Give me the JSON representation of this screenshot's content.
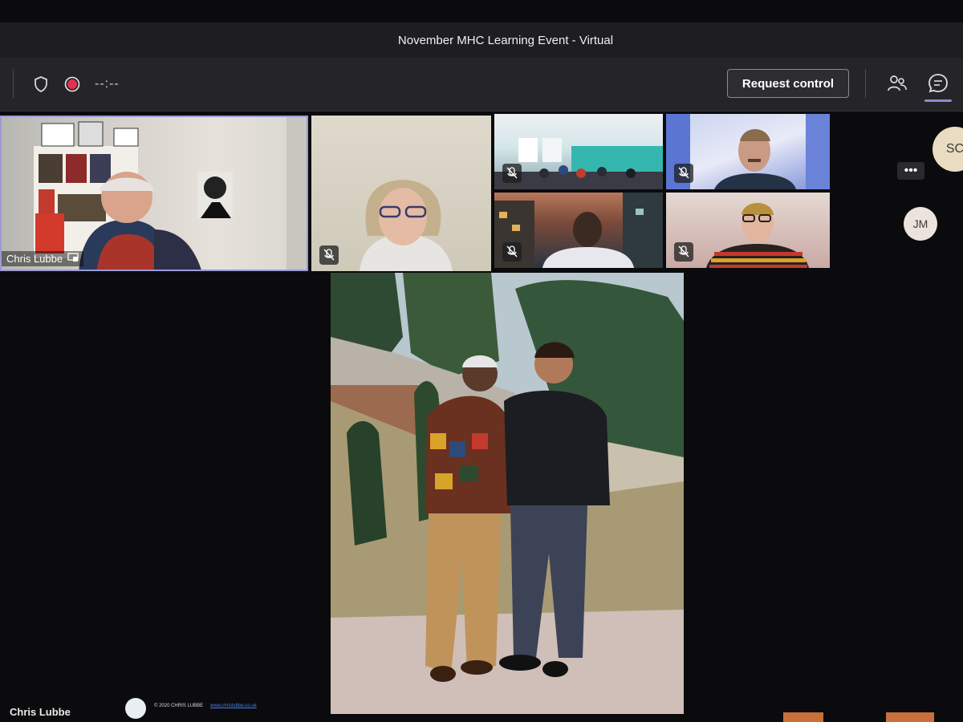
{
  "window": {
    "title": "November MHC Learning Event - Virtual"
  },
  "toolbar": {
    "timer": "--:--",
    "request_control_label": "Request control"
  },
  "participants": {
    "speaker_name": "Chris Lubbe",
    "avatars": [
      "SC",
      "JM"
    ],
    "more_label": "•••"
  },
  "footer": {
    "presenter_name": "Chris Lubbe",
    "copyright": "© 2020 CHRIS LUBBE",
    "link": "www.chrislubbe.co.uk"
  },
  "colors": {
    "accent": "#8b8cc7",
    "record": "#e0324f",
    "toolbar_bg": "#252529",
    "titlebar_bg": "#1d1d22"
  },
  "icons": [
    "shield-icon",
    "record-icon",
    "people-icon",
    "chat-icon",
    "mic-off-icon",
    "share-screen-icon"
  ]
}
